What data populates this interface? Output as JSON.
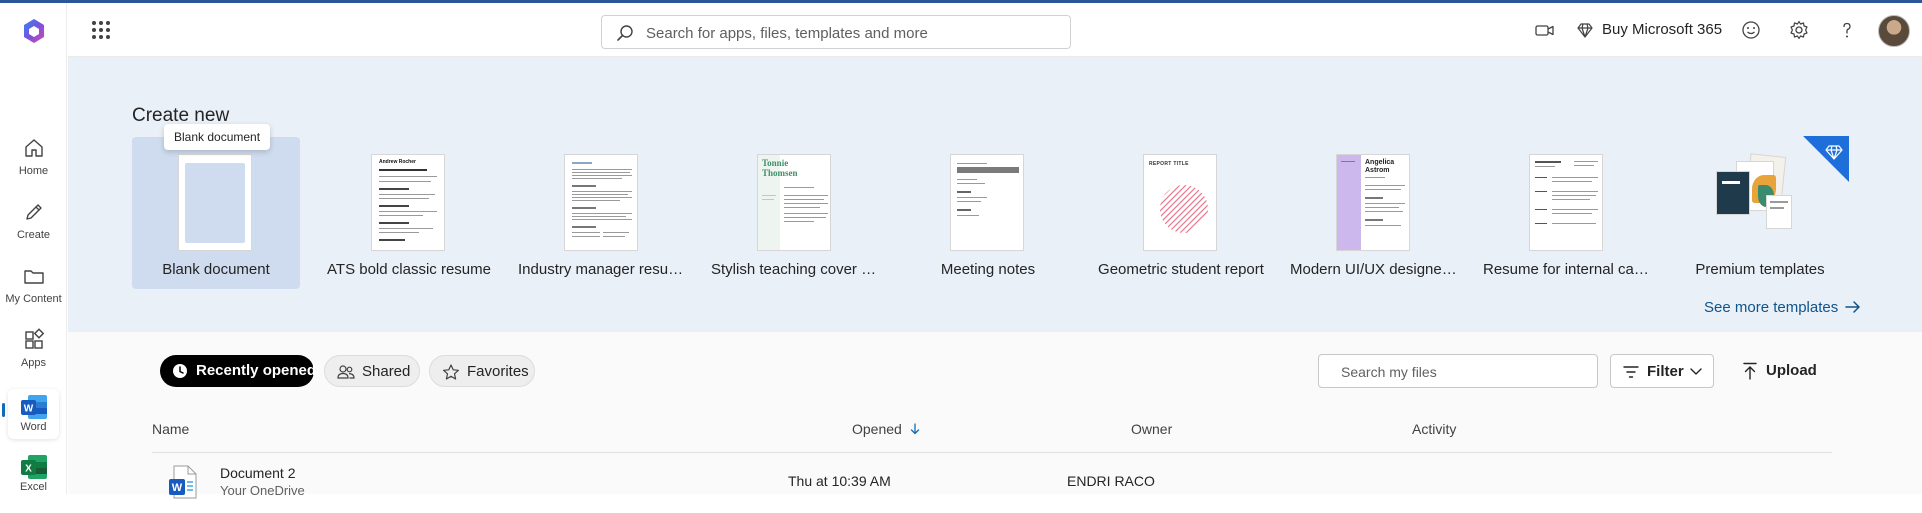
{
  "topbar": {
    "search_placeholder": "Search for apps, files, templates and more",
    "buy_label": "Buy Microsoft 365"
  },
  "rail": {
    "items": [
      {
        "label": "Home",
        "icon": "home-icon"
      },
      {
        "label": "Create",
        "icon": "pen-icon"
      },
      {
        "label": "My Content",
        "icon": "folder-icon"
      },
      {
        "label": "Apps",
        "icon": "apps-icon"
      },
      {
        "label": "Word",
        "icon": "word-icon"
      },
      {
        "label": "Excel",
        "icon": "excel-icon"
      }
    ],
    "active": "Word"
  },
  "create": {
    "title": "Create new",
    "tooltip": "Blank document",
    "templates": [
      {
        "label": "Blank document",
        "selected": true
      },
      {
        "label": "ATS bold classic resume"
      },
      {
        "label": "Industry manager resume"
      },
      {
        "label": "Stylish teaching cover letter"
      },
      {
        "label": "Meeting notes"
      },
      {
        "label": "Geometric student report"
      },
      {
        "label": "Modern UI/UX designer resume"
      },
      {
        "label": "Resume for internal candidate"
      },
      {
        "label": "Premium templates"
      }
    ],
    "thumb_text": {
      "ats_name": "Andrew Rocher",
      "teaching_name_1": "Tonnie",
      "teaching_name_2": "Thomsen",
      "report_title": "REPORT TITLE",
      "uiux_name_1": "Angelica",
      "uiux_name_2": "Astrom"
    },
    "see_more": "See more templates"
  },
  "files": {
    "tabs": [
      {
        "label": "Recently opened",
        "active": true
      },
      {
        "label": "Shared"
      },
      {
        "label": "Favorites"
      }
    ],
    "search_placeholder": "Search my files",
    "filter_label": "Filter",
    "upload_label": "Upload",
    "columns": {
      "name": "Name",
      "opened": "Opened",
      "owner": "Owner",
      "activity": "Activity"
    },
    "rows": [
      {
        "name": "Document 2",
        "location": "Your OneDrive",
        "opened": "Thu at 10:39 AM",
        "owner": "ENDRI RACO",
        "activity": ""
      }
    ]
  },
  "colors": {
    "accent": "#0f6cbd",
    "word_blue": "#185abd",
    "excel_green": "#107c41",
    "create_bg": "#eaf0f8",
    "premium_badge": "#1e6fd9"
  }
}
